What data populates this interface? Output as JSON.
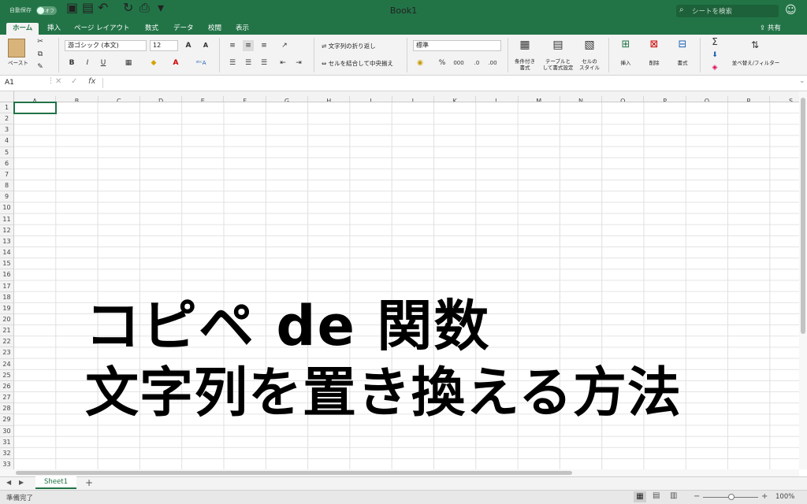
{
  "titlebar": {
    "autosave_label": "自動保存",
    "autosave_state": "オフ",
    "doc_title": "Book1",
    "search_placeholder": "シートを検索"
  },
  "tabs": [
    "ホーム",
    "挿入",
    "ページ レイアウト",
    "数式",
    "データ",
    "校閲",
    "表示"
  ],
  "share_label": "共有",
  "ribbon": {
    "paste_label": "ペースト",
    "font_name": "游ゴシック (本文)",
    "font_size": "12",
    "bold": "B",
    "italic": "I",
    "underline": "U",
    "wrap_text": "文字列の折り返し",
    "merge_center": "セルを結合して中央揃え",
    "number_format": "標準",
    "percent": "%",
    "thousands": "000",
    "cond_format": "条件付き\n書式",
    "table_format": "テーブルと\nして書式設定",
    "cell_style": "セルの\nスタイル",
    "insert": "挿入",
    "delete": "削除",
    "format": "書式",
    "sort_filter": "並べ替え/フィルター"
  },
  "formula_bar": {
    "name_box": "A1",
    "fx": "fx"
  },
  "columns": [
    "A",
    "B",
    "C",
    "D",
    "E",
    "F",
    "G",
    "H",
    "I",
    "J",
    "K",
    "L",
    "M",
    "N",
    "O",
    "P",
    "Q",
    "R",
    "S"
  ],
  "rows": [
    "1",
    "2",
    "3",
    "4",
    "5",
    "6",
    "7",
    "8",
    "9",
    "10",
    "11",
    "12",
    "13",
    "14",
    "15",
    "16",
    "17",
    "18",
    "19",
    "20",
    "21",
    "22",
    "23",
    "24",
    "25",
    "26",
    "27",
    "28",
    "29",
    "30",
    "31",
    "32",
    "33"
  ],
  "overlay": {
    "line1": "コピペ de 関数",
    "line2": "文字列を置き換える方法"
  },
  "sheet_tab": "Sheet1",
  "status": {
    "text": "準備完了",
    "zoom": "100%"
  }
}
